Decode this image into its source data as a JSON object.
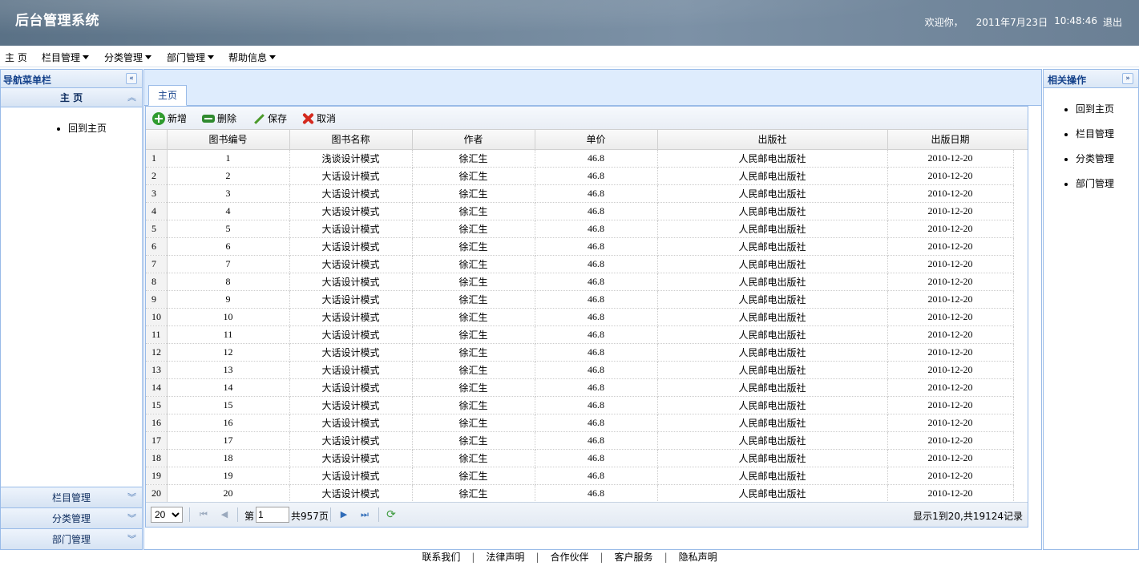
{
  "header": {
    "title": "后台管理系统",
    "welcome": "欢迎你，",
    "date": "2011年7月23日",
    "time": "10:48:46",
    "logout": "退出"
  },
  "menubar": {
    "items": [
      {
        "label": "主 页",
        "has_dropdown": false
      },
      {
        "label": "栏目管理",
        "has_dropdown": true
      },
      {
        "label": "分类管理",
        "has_dropdown": true
      },
      {
        "label": "部门管理",
        "has_dropdown": true
      },
      {
        "label": "帮助信息",
        "has_dropdown": true
      }
    ]
  },
  "left_panel": {
    "title": "导航菜单栏",
    "collapse_icon": "double-chevron-left-icon",
    "sections": [
      {
        "label": "主 页",
        "expanded": true,
        "items": [
          "回到主页"
        ]
      },
      {
        "label": "栏目管理",
        "expanded": false
      },
      {
        "label": "分类管理",
        "expanded": false
      },
      {
        "label": "部门管理",
        "expanded": false
      }
    ]
  },
  "center": {
    "tabs": [
      {
        "label": "主页",
        "active": true
      }
    ],
    "toolbar": {
      "add": "新增",
      "delete": "删除",
      "save": "保存",
      "cancel": "取消"
    },
    "grid": {
      "columns": [
        "图书编号",
        "图书名称",
        "作者",
        "单价",
        "出版社",
        "出版日期"
      ],
      "rows": [
        {
          "n": "1",
          "id": "1",
          "name": "浅谈设计模式",
          "author": "徐汇生",
          "price": "46.8",
          "publisher": "人民邮电出版社",
          "date": "2010-12-20"
        },
        {
          "n": "2",
          "id": "2",
          "name": "大话设计模式",
          "author": "徐汇生",
          "price": "46.8",
          "publisher": "人民邮电出版社",
          "date": "2010-12-20"
        },
        {
          "n": "3",
          "id": "3",
          "name": "大话设计模式",
          "author": "徐汇生",
          "price": "46.8",
          "publisher": "人民邮电出版社",
          "date": "2010-12-20"
        },
        {
          "n": "4",
          "id": "4",
          "name": "大话设计模式",
          "author": "徐汇生",
          "price": "46.8",
          "publisher": "人民邮电出版社",
          "date": "2010-12-20"
        },
        {
          "n": "5",
          "id": "5",
          "name": "大话设计模式",
          "author": "徐汇生",
          "price": "46.8",
          "publisher": "人民邮电出版社",
          "date": "2010-12-20"
        },
        {
          "n": "6",
          "id": "6",
          "name": "大话设计模式",
          "author": "徐汇生",
          "price": "46.8",
          "publisher": "人民邮电出版社",
          "date": "2010-12-20"
        },
        {
          "n": "7",
          "id": "7",
          "name": "大话设计模式",
          "author": "徐汇生",
          "price": "46.8",
          "publisher": "人民邮电出版社",
          "date": "2010-12-20"
        },
        {
          "n": "8",
          "id": "8",
          "name": "大话设计模式",
          "author": "徐汇生",
          "price": "46.8",
          "publisher": "人民邮电出版社",
          "date": "2010-12-20"
        },
        {
          "n": "9",
          "id": "9",
          "name": "大话设计模式",
          "author": "徐汇生",
          "price": "46.8",
          "publisher": "人民邮电出版社",
          "date": "2010-12-20"
        },
        {
          "n": "10",
          "id": "10",
          "name": "大话设计模式",
          "author": "徐汇生",
          "price": "46.8",
          "publisher": "人民邮电出版社",
          "date": "2010-12-20"
        },
        {
          "n": "11",
          "id": "11",
          "name": "大话设计模式",
          "author": "徐汇生",
          "price": "46.8",
          "publisher": "人民邮电出版社",
          "date": "2010-12-20"
        },
        {
          "n": "12",
          "id": "12",
          "name": "大话设计模式",
          "author": "徐汇生",
          "price": "46.8",
          "publisher": "人民邮电出版社",
          "date": "2010-12-20"
        },
        {
          "n": "13",
          "id": "13",
          "name": "大话设计模式",
          "author": "徐汇生",
          "price": "46.8",
          "publisher": "人民邮电出版社",
          "date": "2010-12-20"
        },
        {
          "n": "14",
          "id": "14",
          "name": "大话设计模式",
          "author": "徐汇生",
          "price": "46.8",
          "publisher": "人民邮电出版社",
          "date": "2010-12-20"
        },
        {
          "n": "15",
          "id": "15",
          "name": "大话设计模式",
          "author": "徐汇生",
          "price": "46.8",
          "publisher": "人民邮电出版社",
          "date": "2010-12-20"
        },
        {
          "n": "16",
          "id": "16",
          "name": "大话设计模式",
          "author": "徐汇生",
          "price": "46.8",
          "publisher": "人民邮电出版社",
          "date": "2010-12-20"
        },
        {
          "n": "17",
          "id": "17",
          "name": "大话设计模式",
          "author": "徐汇生",
          "price": "46.8",
          "publisher": "人民邮电出版社",
          "date": "2010-12-20"
        },
        {
          "n": "18",
          "id": "18",
          "name": "大话设计模式",
          "author": "徐汇生",
          "price": "46.8",
          "publisher": "人民邮电出版社",
          "date": "2010-12-20"
        },
        {
          "n": "19",
          "id": "19",
          "name": "大话设计模式",
          "author": "徐汇生",
          "price": "46.8",
          "publisher": "人民邮电出版社",
          "date": "2010-12-20"
        },
        {
          "n": "20",
          "id": "20",
          "name": "大话设计模式",
          "author": "徐汇生",
          "price": "46.8",
          "publisher": "人民邮电出版社",
          "date": "2010-12-20"
        }
      ]
    },
    "pager": {
      "page_size": "20",
      "page_prefix": "第",
      "page_value": "1",
      "page_total": "共957页",
      "info": "显示1到20,共19124记录"
    }
  },
  "right_panel": {
    "title": "相关操作",
    "expand_icon": "double-chevron-right-icon",
    "items": [
      "回到主页",
      "栏目管理",
      "分类管理",
      "部门管理"
    ]
  },
  "footer": {
    "links": [
      "联系我们",
      "法律声明",
      "合作伙伴",
      "客户服务",
      "隐私声明"
    ],
    "separator": "|"
  }
}
